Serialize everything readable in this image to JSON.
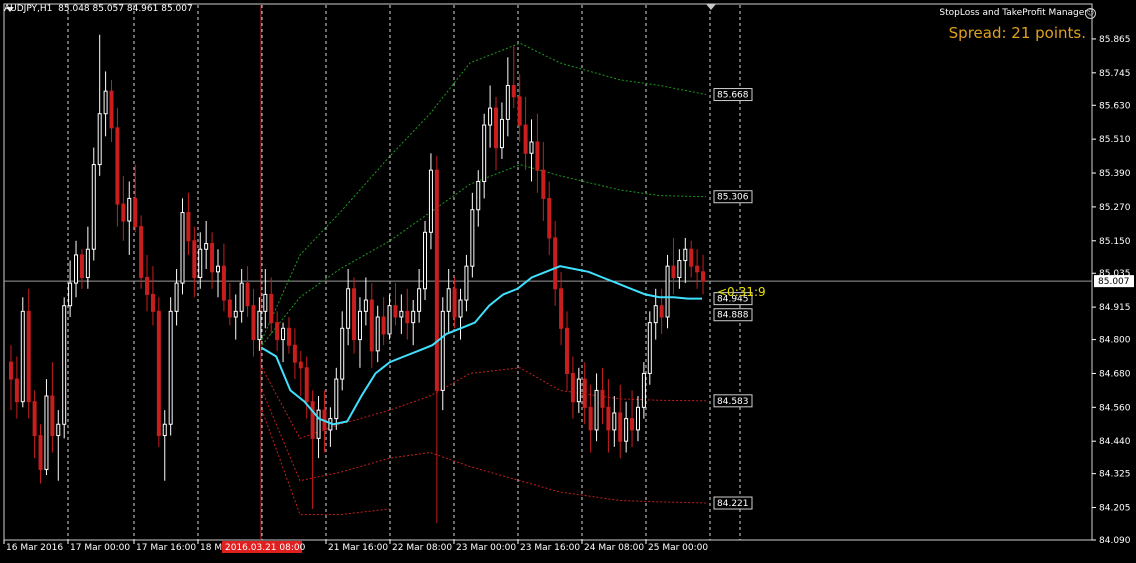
{
  "header": {
    "symbol": "AUDJPY,H1",
    "ohlc": "85.048 85.057 84.961 85.007",
    "manager": "StopLoss and TakeProfit Manager",
    "spread": "Spread: 21 points."
  },
  "colors": {
    "background": "#000000",
    "grid": "#ffffff",
    "axis": "#ffffff",
    "bull_candle": "#ffffff",
    "bear_candle": "#c81e1e",
    "ma_line": "#40e0ff",
    "upper_band": "#1e9a1e",
    "lower_band": "#c81e1e",
    "red_vline": "#d02020",
    "bid_line": "#9a9a9a",
    "counter_text": "#e8e000"
  },
  "chart_data": {
    "type": "candlestick",
    "symbol": "AUDJPY",
    "timeframe": "H1",
    "ylim": [
      84.09,
      85.925
    ],
    "y_ticks": [
      "85.865",
      "85.745",
      "85.630",
      "85.510",
      "85.390",
      "85.270",
      "85.150",
      "85.035",
      "84.915",
      "84.800",
      "84.680",
      "84.560",
      "84.440",
      "84.325",
      "84.205",
      "84.090"
    ],
    "x_ticks": [
      "16 Mar 2016",
      "17 Mar 00:00",
      "17 Mar 16:00",
      "18 Mar",
      "21 Mar 16:00",
      "22 Mar 08:00",
      "23 Mar 00:00",
      "23 Mar 16:00",
      "24 Mar 08:00",
      "25 Mar 00:00"
    ],
    "current_price": "85.007",
    "highlighted_time": "2016.03.21 08:00",
    "counter_text": "<0:31:9",
    "levels": [
      {
        "label": "85.668",
        "value": 85.668
      },
      {
        "label": "85.306",
        "value": 85.306
      },
      {
        "label": "84.945",
        "value": 84.945
      },
      {
        "label": "84.888",
        "value": 84.888
      },
      {
        "label": "84.583",
        "value": 84.583
      },
      {
        "label": "84.221",
        "value": 84.221
      }
    ],
    "candles": [
      [
        84.72,
        84.78,
        84.55,
        84.66
      ],
      [
        84.66,
        84.74,
        84.52,
        84.58
      ],
      [
        84.58,
        84.95,
        84.56,
        84.9
      ],
      [
        84.9,
        84.98,
        84.52,
        84.58
      ],
      [
        84.58,
        84.62,
        84.38,
        84.46
      ],
      [
        84.46,
        84.5,
        84.29,
        84.34
      ],
      [
        84.34,
        84.66,
        84.32,
        84.6
      ],
      [
        84.6,
        84.72,
        84.4,
        84.46
      ],
      [
        84.46,
        84.55,
        84.3,
        84.5
      ],
      [
        84.5,
        84.95,
        84.45,
        84.92
      ],
      [
        84.92,
        85.08,
        84.88,
        85.0
      ],
      [
        85.0,
        85.15,
        84.95,
        85.1
      ],
      [
        85.1,
        85.12,
        84.98,
        85.02
      ],
      [
        85.02,
        85.2,
        84.98,
        85.12
      ],
      [
        85.12,
        85.48,
        85.08,
        85.42
      ],
      [
        85.42,
        85.88,
        85.38,
        85.6
      ],
      [
        85.6,
        85.75,
        85.52,
        85.68
      ],
      [
        85.68,
        85.72,
        85.5,
        85.55
      ],
      [
        85.55,
        85.62,
        85.2,
        85.28
      ],
      [
        85.28,
        85.38,
        85.15,
        85.22
      ],
      [
        85.22,
        85.36,
        85.1,
        85.3
      ],
      [
        85.3,
        85.42,
        85.18,
        85.2
      ],
      [
        85.2,
        85.24,
        84.98,
        85.02
      ],
      [
        85.02,
        85.1,
        84.9,
        84.96
      ],
      [
        84.96,
        85.06,
        84.85,
        84.9
      ],
      [
        84.9,
        84.95,
        84.42,
        84.46
      ],
      [
        84.46,
        84.55,
        84.3,
        84.5
      ],
      [
        84.5,
        84.95,
        84.46,
        84.9
      ],
      [
        84.9,
        85.05,
        84.85,
        85.0
      ],
      [
        85.0,
        85.3,
        84.96,
        85.25
      ],
      [
        85.25,
        85.32,
        85.1,
        85.15
      ],
      [
        85.15,
        85.2,
        84.95,
        85.02
      ],
      [
        85.02,
        85.18,
        84.98,
        85.12
      ],
      [
        85.12,
        85.22,
        85.05,
        85.14
      ],
      [
        85.14,
        85.18,
        84.98,
        85.04
      ],
      [
        85.04,
        85.12,
        84.95,
        85.06
      ],
      [
        85.06,
        85.14,
        84.9,
        84.94
      ],
      [
        84.94,
        85.0,
        84.85,
        84.88
      ],
      [
        84.88,
        84.96,
        84.8,
        84.9
      ],
      [
        84.9,
        85.05,
        84.86,
        85.0
      ],
      [
        85.0,
        85.06,
        84.88,
        84.92
      ],
      [
        84.92,
        84.98,
        84.74,
        84.8
      ],
      [
        84.8,
        84.95,
        84.76,
        84.9
      ],
      [
        84.9,
        85.05,
        84.84,
        84.96
      ],
      [
        84.96,
        85.02,
        84.82,
        84.86
      ],
      [
        84.86,
        84.9,
        84.76,
        84.8
      ],
      [
        84.8,
        84.86,
        84.72,
        84.84
      ],
      [
        84.84,
        84.88,
        84.75,
        84.78
      ],
      [
        84.78,
        84.84,
        84.66,
        84.72
      ],
      [
        84.72,
        84.76,
        84.6,
        84.7
      ],
      [
        84.7,
        84.74,
        84.52,
        84.58
      ],
      [
        84.58,
        84.62,
        84.2,
        84.45
      ],
      [
        84.45,
        84.6,
        84.38,
        84.55
      ],
      [
        84.55,
        84.62,
        84.4,
        84.48
      ],
      [
        84.48,
        84.56,
        84.42,
        84.52
      ],
      [
        84.52,
        84.7,
        84.48,
        84.66
      ],
      [
        84.66,
        84.9,
        84.62,
        84.84
      ],
      [
        84.84,
        85.05,
        84.78,
        84.98
      ],
      [
        84.98,
        85.02,
        84.75,
        84.8
      ],
      [
        84.8,
        84.95,
        84.7,
        84.9
      ],
      [
        84.9,
        85.02,
        84.85,
        84.94
      ],
      [
        84.94,
        85.0,
        84.7,
        84.76
      ],
      [
        84.76,
        84.92,
        84.72,
        84.88
      ],
      [
        84.88,
        84.95,
        84.78,
        84.82
      ],
      [
        84.82,
        84.96,
        84.8,
        84.92
      ],
      [
        84.92,
        85.0,
        84.85,
        84.88
      ],
      [
        84.88,
        84.96,
        84.82,
        84.9
      ],
      [
        84.9,
        84.98,
        84.8,
        84.86
      ],
      [
        84.86,
        84.94,
        84.78,
        84.9
      ],
      [
        84.9,
        85.05,
        84.86,
        84.98
      ],
      [
        84.98,
        85.22,
        84.94,
        85.18
      ],
      [
        85.18,
        85.46,
        85.12,
        85.4
      ],
      [
        85.4,
        85.45,
        84.15,
        84.62
      ],
      [
        84.62,
        84.95,
        84.55,
        84.9
      ],
      [
        84.9,
        85.05,
        84.82,
        84.98
      ],
      [
        84.98,
        85.02,
        84.84,
        84.88
      ],
      [
        84.88,
        84.98,
        84.8,
        84.94
      ],
      [
        84.94,
        85.1,
        84.9,
        85.06
      ],
      [
        85.06,
        85.32,
        85.02,
        85.26
      ],
      [
        85.26,
        85.4,
        85.2,
        85.36
      ],
      [
        85.36,
        85.6,
        85.3,
        85.56
      ],
      [
        85.56,
        85.7,
        85.48,
        85.62
      ],
      [
        85.62,
        85.66,
        85.4,
        85.48
      ],
      [
        85.48,
        85.64,
        85.44,
        85.58
      ],
      [
        85.58,
        85.8,
        85.52,
        85.7
      ],
      [
        85.7,
        85.84,
        85.62,
        85.66
      ],
      [
        85.66,
        85.74,
        85.5,
        85.56
      ],
      [
        85.56,
        85.66,
        85.4,
        85.46
      ],
      [
        85.46,
        85.58,
        85.36,
        85.5
      ],
      [
        85.5,
        85.6,
        85.32,
        85.4
      ],
      [
        85.4,
        85.5,
        85.22,
        85.3
      ],
      [
        85.3,
        85.36,
        85.1,
        85.16
      ],
      [
        85.16,
        85.22,
        84.92,
        84.98
      ],
      [
        84.98,
        85.04,
        84.78,
        84.84
      ],
      [
        84.84,
        84.9,
        84.62,
        84.68
      ],
      [
        84.68,
        84.74,
        84.52,
        84.58
      ],
      [
        84.58,
        84.7,
        84.54,
        84.66
      ],
      [
        84.66,
        84.72,
        84.5,
        84.56
      ],
      [
        84.56,
        84.64,
        84.4,
        84.48
      ],
      [
        84.48,
        84.68,
        84.44,
        84.62
      ],
      [
        84.62,
        84.7,
        84.5,
        84.56
      ],
      [
        84.56,
        84.66,
        84.4,
        84.48
      ],
      [
        84.48,
        84.6,
        84.42,
        84.54
      ],
      [
        84.54,
        84.64,
        84.38,
        84.44
      ],
      [
        84.44,
        84.58,
        84.4,
        84.52
      ],
      [
        84.52,
        84.62,
        84.42,
        84.48
      ],
      [
        84.48,
        84.6,
        84.44,
        84.56
      ],
      [
        84.56,
        84.72,
        84.52,
        84.68
      ],
      [
        84.68,
        84.9,
        84.64,
        84.86
      ],
      [
        84.86,
        84.98,
        84.8,
        84.92
      ],
      [
        84.92,
        84.98,
        84.82,
        84.88
      ],
      [
        84.88,
        85.1,
        84.84,
        85.06
      ],
      [
        85.06,
        85.16,
        84.96,
        85.02
      ],
      [
        85.02,
        85.12,
        84.98,
        85.08
      ],
      [
        85.08,
        85.16,
        85.0,
        85.12
      ],
      [
        85.12,
        85.15,
        85.02,
        85.06
      ],
      [
        85.06,
        85.12,
        84.98,
        85.04
      ],
      [
        85.04,
        85.1,
        84.96,
        85.007
      ]
    ],
    "ma_line": [
      [
        84.77,
        84.74,
        84.62,
        84.58,
        84.52,
        84.5,
        84.51
      ],
      [
        84.6,
        84.68,
        84.72,
        84.74,
        84.76,
        84.78,
        84.82
      ],
      [
        84.84,
        84.86,
        84.92,
        84.96,
        84.98,
        85.02,
        85.04,
        85.06
      ],
      [
        85.05,
        85.04,
        85.02,
        85.0,
        84.98,
        84.96,
        84.95,
        84.95,
        84.945,
        84.945
      ]
    ]
  }
}
